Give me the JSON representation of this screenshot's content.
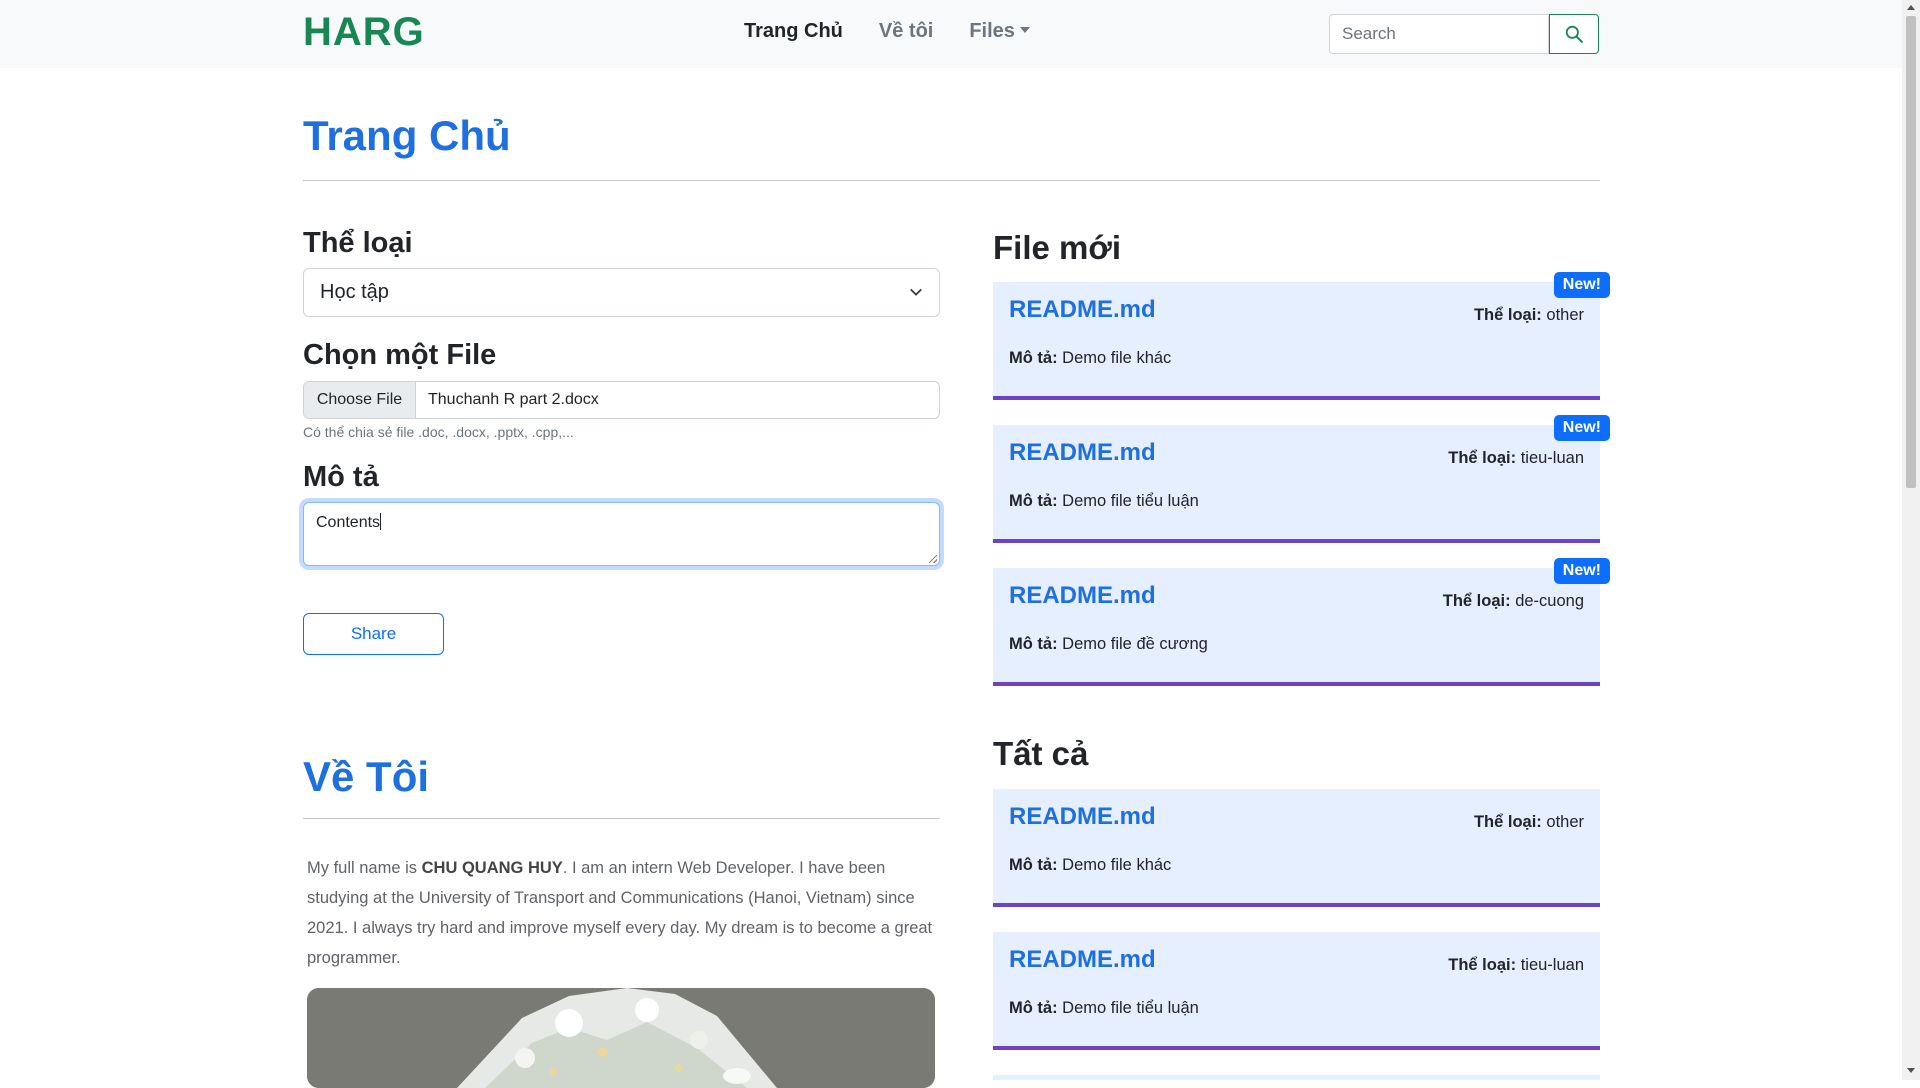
{
  "navbar": {
    "brand": "HARG",
    "links": [
      {
        "label": "Trang Chủ"
      },
      {
        "label": "Về tôi"
      },
      {
        "label": "Files"
      }
    ],
    "search_placeholder": "Search"
  },
  "home": {
    "title": "Trang Chủ",
    "category_label": "Thể loại",
    "category_value": "Học tập",
    "file_label": "Chọn một File",
    "choose_file_button": "Choose File",
    "chosen_file": "Thuchanh R part 2.docx",
    "file_hint": "Có thể chia sẻ file .doc, .docx, .pptx, .cpp,...",
    "description_label": "Mô tả",
    "description_value": "Contents",
    "share_button": "Share"
  },
  "about": {
    "title": "Về Tôi",
    "text_before": "My full name is ",
    "name": "CHU QUANG HUY",
    "text_after": ". I am an intern Web Developer. I have been studying at the University of Transport and Communications (Hanoi, Vietnam) since 2021. I always try hard and improve myself every day. My dream is to become a great programmer."
  },
  "new_files": {
    "title": "File mới",
    "category_key": "Thể loại:",
    "desc_key": "Mô tả:",
    "badge": "New!",
    "items": [
      {
        "name": "README.md",
        "category": "other",
        "desc": "Demo file khác"
      },
      {
        "name": "README.md",
        "category": "tieu-luan",
        "desc": "Demo file tiểu luận"
      },
      {
        "name": "README.md",
        "category": "de-cuong",
        "desc": "Demo file đề cương"
      }
    ]
  },
  "all_files": {
    "title": "Tất cả",
    "items": [
      {
        "name": "README.md",
        "category": "other",
        "desc": "Demo file khác"
      },
      {
        "name": "README.md",
        "category": "tieu-luan",
        "desc": "Demo file tiểu luận"
      }
    ]
  },
  "colors": {
    "brand": "#198754",
    "heading_blue": "#1e6fe0",
    "card_bg": "#e6efff",
    "card_border": "#6f42c1",
    "badge": "#0d6efd"
  }
}
